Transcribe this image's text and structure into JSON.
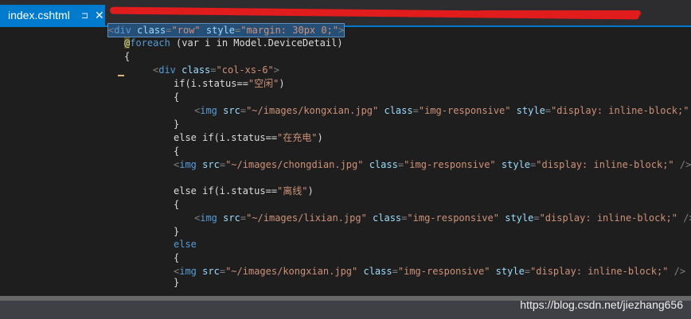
{
  "tabs": {
    "active": {
      "label": "index.cshtml",
      "pin": "⊐",
      "close": "✕"
    }
  },
  "watermark": "https://blog.csdn.net/jiezhang656",
  "code": {
    "l1": {
      "open": "<",
      "tag": "div",
      "attr1": "class",
      "eq1": "=",
      "val1": "\"row\"",
      "attr2": "style",
      "eq2": "=",
      "val2": "\"margin: 30px 0;\"",
      "close": ">"
    },
    "l2": {
      "at": "@",
      "kw": "foreach",
      "rest": " (var i in Model.DeviceDetail)"
    },
    "l3": {
      "text": "{"
    },
    "l4": {
      "open": "<",
      "tag": "div",
      "attr1": "class",
      "eq1": "=",
      "val1": "\"col-xs-6\"",
      "close": ">"
    },
    "l5": {
      "text": "if(i.status==",
      "str": "\"空闲\"",
      "end": ")"
    },
    "l6": {
      "text": "{"
    },
    "l7": {
      "open": "<",
      "tag": "img",
      "attr1": "src",
      "eq1": "=",
      "val1": "\"~/images/kongxian.jpg\"",
      "attr2": "class",
      "eq2": "=",
      "val2": "\"img-responsive\"",
      "attr3": "style",
      "eq3": "=",
      "val3": "\"display: inline-block;\"",
      "close": " />"
    },
    "l8": {
      "text": "}"
    },
    "l9": {
      "text": "else if(i.status==",
      "str": "\"在充电\"",
      "end": ")"
    },
    "l10": {
      "text": "{"
    },
    "l11": {
      "open": "<",
      "tag": "img",
      "attr1": "src",
      "eq1": "=",
      "val1": "\"~/images/chongdian.jpg\"",
      "attr2": "class",
      "eq2": "=",
      "val2": "\"img-responsive\"",
      "attr3": "style",
      "eq3": "=",
      "val3": "\"display: inline-block;\"",
      "close": " />"
    },
    "l12": {
      "text": "else if(i.status==",
      "str": "\"离线\"",
      "end": ")"
    },
    "l13": {
      "text": "{"
    },
    "l14": {
      "open": "<",
      "tag": "img",
      "attr1": "src",
      "eq1": "=",
      "val1": "\"~/images/lixian.jpg\"",
      "attr2": "class",
      "eq2": "=",
      "val2": "\"img-responsive\"",
      "attr3": "style",
      "eq3": "=",
      "val3": "\"display: inline-block;\"",
      "close": " />"
    },
    "l15": {
      "text": "}"
    },
    "l16": {
      "text": "else"
    },
    "l17": {
      "text": "{"
    },
    "l18": {
      "open": "<",
      "tag": "img",
      "attr1": "src",
      "eq1": "=",
      "val1": "\"~/images/kongxian.jpg\"",
      "attr2": "class",
      "eq2": "=",
      "val2": "\"img-responsive\"",
      "attr3": "style",
      "eq3": "=",
      "val3": "\"display: inline-block;\"",
      "close": " />"
    },
    "l19": {
      "text": "}"
    }
  }
}
